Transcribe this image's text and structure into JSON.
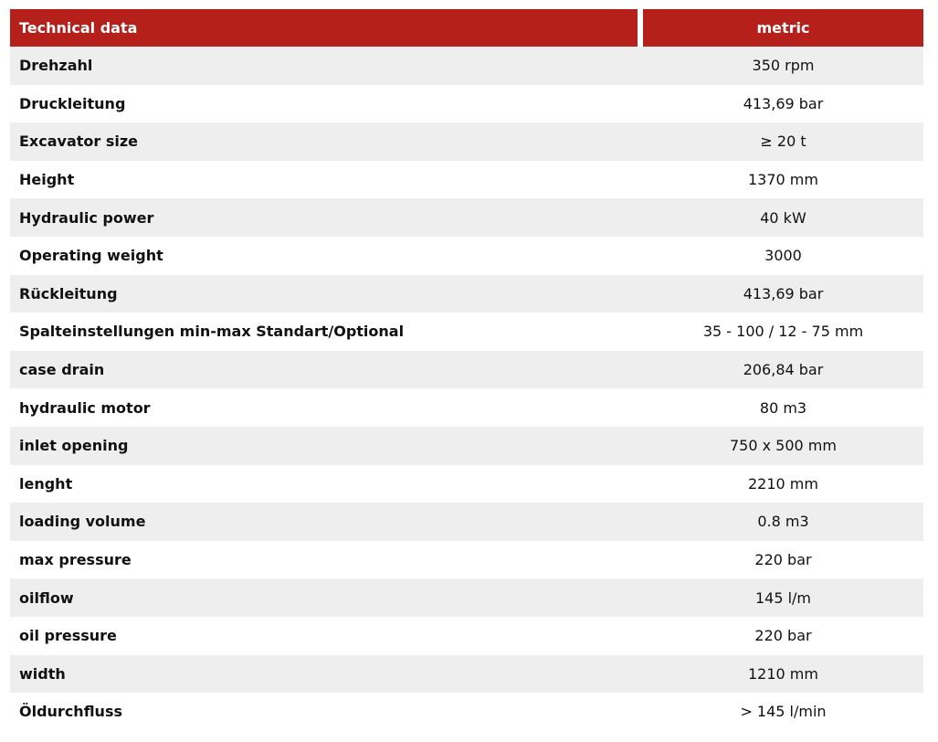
{
  "table": {
    "header": {
      "label": "Technical data",
      "unit_system": "metric"
    },
    "rows": [
      {
        "label": "Drehzahl",
        "value": "350 rpm"
      },
      {
        "label": "Druckleitung",
        "value": "413,69 bar"
      },
      {
        "label": "Excavator size",
        "value": "≥ 20 t"
      },
      {
        "label": "Height",
        "value": "1370 mm"
      },
      {
        "label": "Hydraulic power",
        "value": "40 kW"
      },
      {
        "label": "Operating weight",
        "value": "3000"
      },
      {
        "label": "Rückleitung",
        "value": "413,69 bar"
      },
      {
        "label": "Spalteinstellungen min-max Standart/Optional",
        "value": "35 - 100 / 12 - 75 mm"
      },
      {
        "label": "case drain",
        "value": "206,84 bar"
      },
      {
        "label": "hydraulic motor",
        "value": "80 m3"
      },
      {
        "label": "inlet opening",
        "value": "750 x 500 mm"
      },
      {
        "label": "lenght",
        "value": "2210 mm"
      },
      {
        "label": "loading volume",
        "value": "0.8 m3"
      },
      {
        "label": "max pressure",
        "value": "220 bar"
      },
      {
        "label": "oilflow",
        "value": "145 l/m"
      },
      {
        "label": "oil pressure",
        "value": "220 bar"
      },
      {
        "label": "width",
        "value": "1210 mm"
      },
      {
        "label": "Öldurchfluss",
        "value": "> 145 l/min"
      }
    ]
  },
  "colors": {
    "header_bg": "#b5211a",
    "header_text": "#ffffff",
    "row_shaded": "#eeeeee",
    "row_plain": "#ffffff"
  }
}
